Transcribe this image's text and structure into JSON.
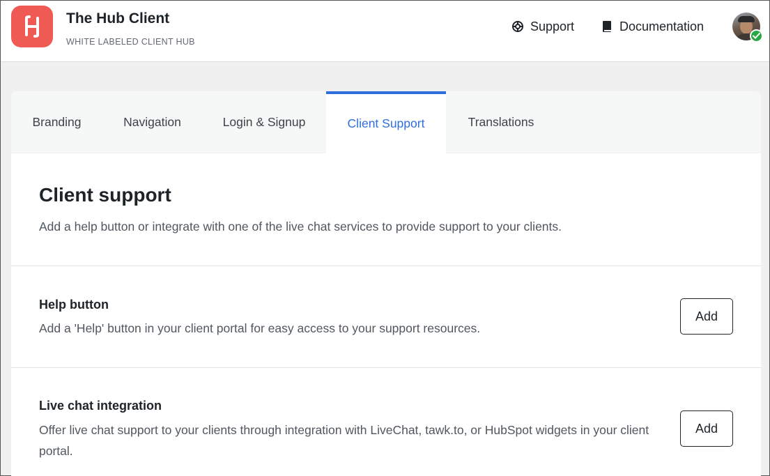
{
  "header": {
    "title": "The Hub Client",
    "subtitle": "WHITE LABELED CLIENT HUB",
    "support_label": "Support",
    "docs_label": "Documentation",
    "brand_color": "#f05a55"
  },
  "tabs": [
    {
      "label": "Branding",
      "active": false
    },
    {
      "label": "Navigation",
      "active": false
    },
    {
      "label": "Login & Signup",
      "active": false
    },
    {
      "label": "Client Support",
      "active": true
    },
    {
      "label": "Translations",
      "active": false
    }
  ],
  "main": {
    "title": "Client support",
    "description": "Add a help button or integrate with one of the live chat services to provide support to your clients.",
    "rows": [
      {
        "title": "Help button",
        "description": "Add a 'Help' button in your client portal for easy access to your support resources.",
        "button_label": "Add"
      },
      {
        "title": "Live chat integration",
        "description": "Offer live chat support to your clients through integration with LiveChat, tawk.to, or HubSpot widgets in your client portal.",
        "button_label": "Add"
      }
    ]
  },
  "icons": {
    "logo": "hub-logo-icon",
    "support": "life-ring-icon",
    "docs": "book-icon",
    "status": "check-icon"
  },
  "colors": {
    "accent": "#2f6fdd",
    "status_online": "#28a745"
  }
}
